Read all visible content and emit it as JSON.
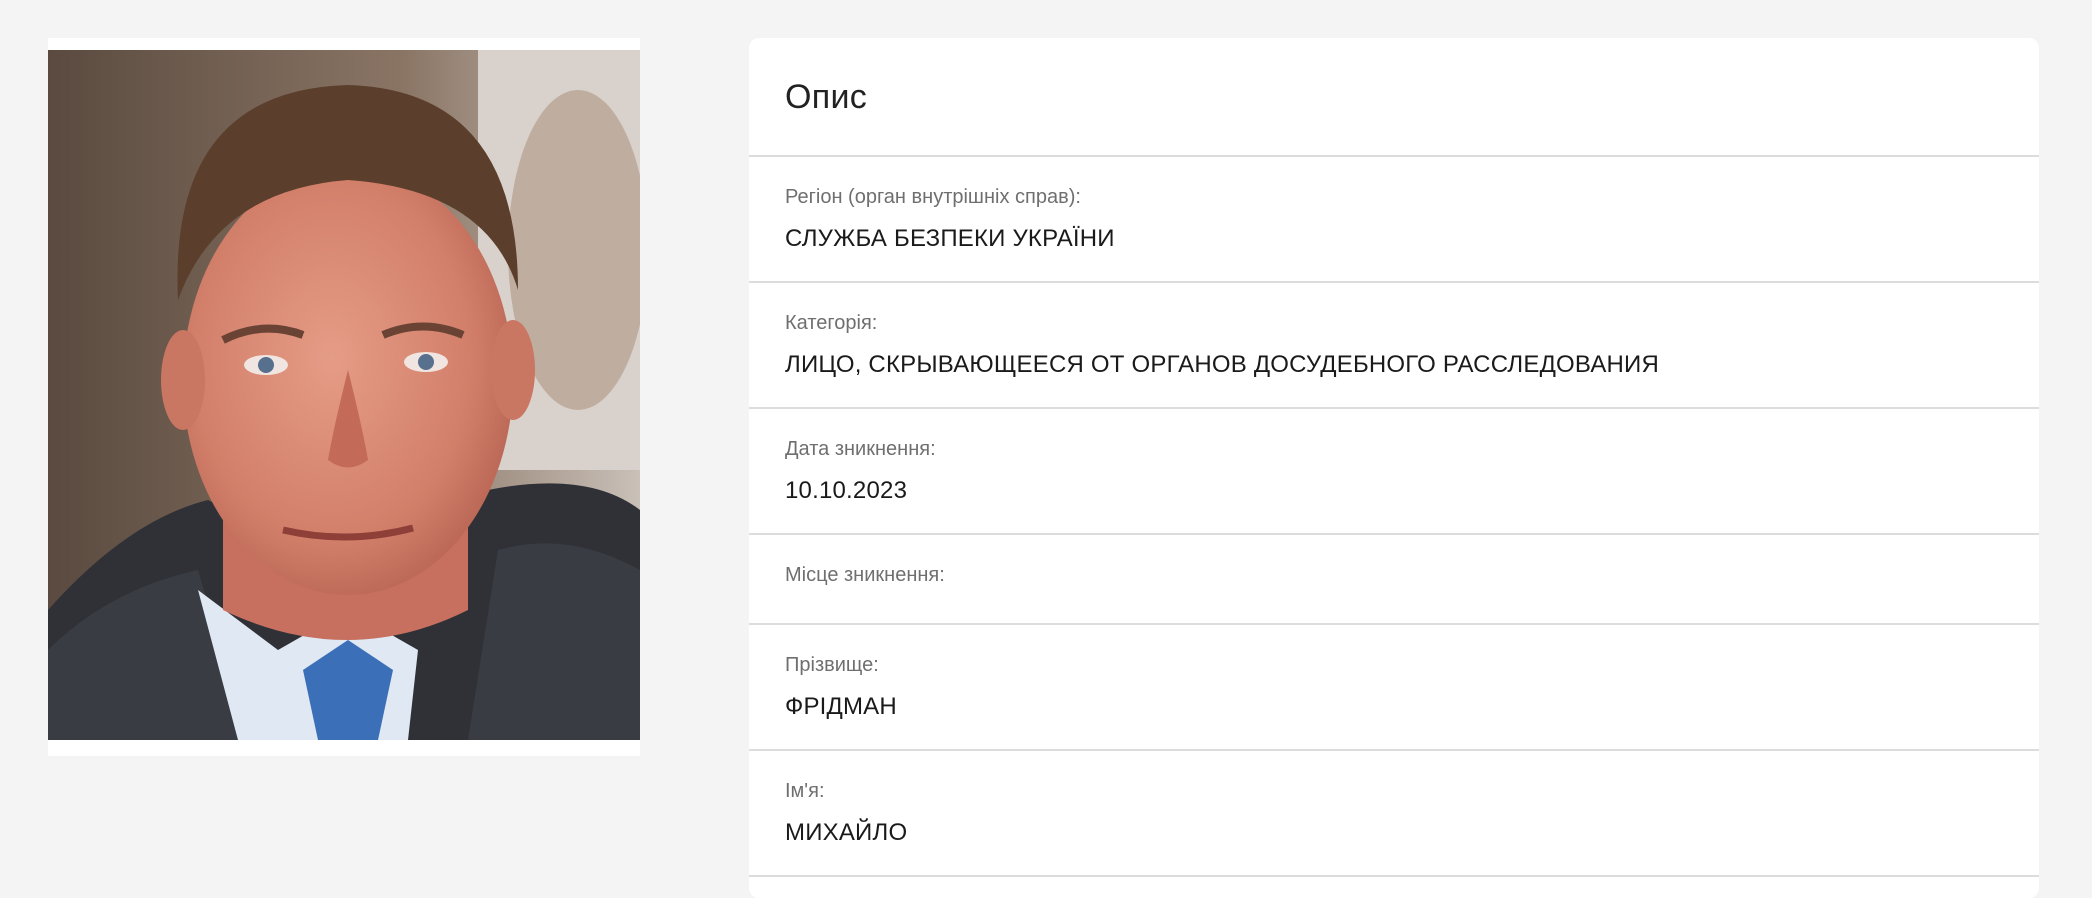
{
  "description": {
    "title": "Опис",
    "fields": [
      {
        "label": "Регіон (орган внутрішніх справ):",
        "value": "СЛУЖБА БЕЗПЕКИ УКРАЇНИ"
      },
      {
        "label": "Категорія:",
        "value": "ЛИЦО, СКРЫВАЮЩЕЕСЯ ОТ ОРГАНОВ ДОСУДЕБНОГО РАССЛЕДОВАНИЯ"
      },
      {
        "label": "Дата зникнення:",
        "value": "10.10.2023"
      },
      {
        "label": "Місце зникнення:",
        "value": ""
      },
      {
        "label": "Прізвище:",
        "value": "ФРІДМАН"
      },
      {
        "label": "Ім'я:",
        "value": "МИХАЙЛО"
      }
    ]
  },
  "colors": {
    "page_background": "#f4f4f4",
    "card_background": "#ffffff",
    "divider": "#dcdcdc",
    "label_text": "#6f6f6f",
    "value_text": "#1a1a1a"
  }
}
